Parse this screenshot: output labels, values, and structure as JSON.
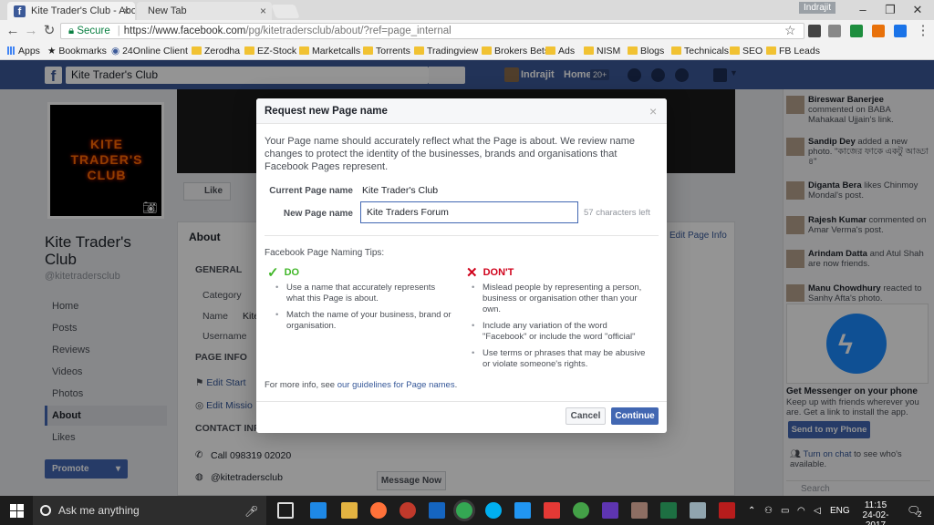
{
  "browser": {
    "tabs": [
      {
        "title": "Kite Trader's Club - Abou",
        "active": true
      },
      {
        "title": "New Tab",
        "active": false
      }
    ],
    "profile": "Indrajit",
    "secure_label": "Secure",
    "url_main": "https://www.facebook.com",
    "url_rest": "/pg/kitetradersclub/about/?ref=page_internal",
    "bookmarks": [
      "Apps",
      "Bookmarks",
      "24Online Client",
      "Zerodha",
      "EZ-Stock",
      "Marketcalls",
      "Torrents",
      "Tradingview",
      "Brokers Bets",
      "Ads",
      "NISM",
      "Blogs",
      "Technicals",
      "SEO",
      "FB Leads"
    ]
  },
  "facebook": {
    "search_value": "Kite Trader's Club",
    "user_name": "Indrajit",
    "home_label": "Home",
    "home_badge": "20+",
    "cover_logo": "KITE TRADER'S CLUB",
    "page_name": "Kite Trader's Club",
    "page_handle": "@kitetradersclub",
    "like_label": "Like",
    "sidebar": [
      "Home",
      "Posts",
      "Reviews",
      "Videos",
      "Photos",
      "About",
      "Likes"
    ],
    "sidebar_active": "About",
    "promote_label": "Promote",
    "about_heading": "About",
    "edit_page_info": "Edit Page Info",
    "general_heading": "GENERAL",
    "category_label": "Category",
    "name_label": "Name",
    "name_value_trunc": "Kite",
    "username_label": "Username",
    "page_info_heading": "PAGE INFO",
    "edit_start": "Edit Start",
    "edit_mission": "Edit Missio",
    "contact_heading": "CONTACT INF",
    "call": "Call 098319 02020",
    "handle": "@kitetradersclub",
    "message_now": "Message Now"
  },
  "ticker": [
    {
      "name": "Bireswar Banerjee",
      "text": " commented on BABA Mahakaal Ujjain's link."
    },
    {
      "name": "Sandip Dey",
      "text": " added a new photo. \"কাজের ফাকে একটু আড্ডা ৪\""
    },
    {
      "name": "Diganta Bera",
      "text": " likes Chinmoy Mondal's post."
    },
    {
      "name": "Rajesh Kumar",
      "text": " commented on Amar Verma's post."
    },
    {
      "name": "Arindam Datta",
      "text": " and Atul Shah are now friends."
    },
    {
      "name": "Manu Chowdhury",
      "text": " reacted to Sanhy Afta's photo."
    }
  ],
  "messenger": {
    "heading": "Get Messenger on your phone",
    "text": "Keep up with friends wherever you are. Get a link to install the app.",
    "send_label": "Send to my Phone",
    "chat_link": "Turn on chat",
    "chat_rest": " to see who's available.",
    "search_placeholder": "Search"
  },
  "dialog": {
    "title": "Request new Page name",
    "intro": "Your Page name should accurately reflect what the Page is about. We review name changes to protect the identity of the businesses, brands and organisations that Facebook Pages represent.",
    "current_label": "Current Page name",
    "current_value": "Kite Trader's Club",
    "new_label": "New Page name",
    "new_value": "Kite Traders Forum",
    "chars_left": "57 characters left",
    "tips_heading": "Facebook Page Naming Tips:",
    "do_heading": "DO",
    "do_items": [
      "Use a name that accurately represents what this Page is about.",
      "Match the name of your business, brand or organisation."
    ],
    "dont_heading": "DON'T",
    "dont_items": [
      "Mislead people by representing a person, business or organisation other than your own.",
      "Include any variation of the word \"Facebook\" or include the word \"official\"",
      "Use terms or phrases that may be abusive or violate someone's rights."
    ],
    "more_prefix": "For more info, see ",
    "more_link": "our guidelines for Page names",
    "more_suffix": ".",
    "cancel": "Cancel",
    "continue": "Continue"
  },
  "taskbar": {
    "search_placeholder": "Ask me anything",
    "lang": "ENG",
    "time": "11:15",
    "date": "24-02-2017",
    "notif_count": "2"
  },
  "colors": {
    "facebook_blue": "#3b5998",
    "button_blue": "#4267b2",
    "do_green": "#42b72a",
    "dont_red": "#d0021b"
  }
}
